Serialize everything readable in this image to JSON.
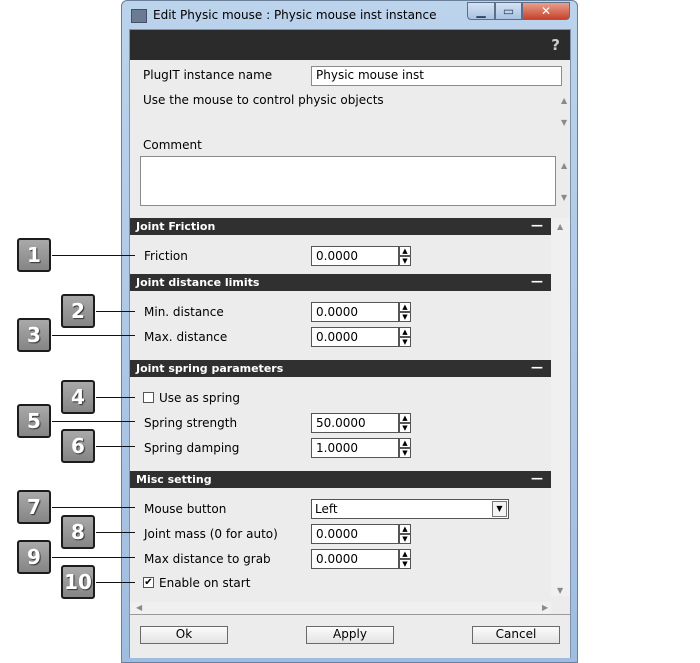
{
  "window": {
    "title": "Edit Physic mouse : Physic mouse inst instance",
    "minimize_glyph": "▁",
    "maximize_glyph": "▭",
    "close_glyph": "✕",
    "help_glyph": "?"
  },
  "instance": {
    "name_label": "PlugIT instance name",
    "name_value": "Physic mouse inst",
    "description": "Use the mouse to control physic objects",
    "comment_label": "Comment",
    "comment_value": ""
  },
  "sections": {
    "joint_friction": "Joint Friction",
    "joint_distance": "Joint distance limits",
    "joint_spring": "Joint spring parameters",
    "misc": "Misc setting",
    "collapse_glyph": "—"
  },
  "fields": {
    "friction": {
      "label": "Friction",
      "value": "0.0000"
    },
    "min_distance": {
      "label": "Min. distance",
      "value": "0.0000"
    },
    "max_distance": {
      "label": "Max. distance",
      "value": "0.0000"
    },
    "use_as_spring": {
      "label": "Use as spring",
      "checked_glyph": ""
    },
    "spring_strength": {
      "label": "Spring strength",
      "value": "50.0000"
    },
    "spring_damping": {
      "label": "Spring damping",
      "value": "1.0000"
    },
    "mouse_button": {
      "label": "Mouse button",
      "value": "Left"
    },
    "joint_mass": {
      "label": "Joint mass (0 for auto)",
      "value": "0.0000"
    },
    "max_grab_distance": {
      "label": "Max distance to grab",
      "value": "0.0000"
    },
    "enable_on_start": {
      "label": "Enable on start",
      "checked_glyph": "✔"
    }
  },
  "buttons": {
    "ok": "Ok",
    "apply": "Apply",
    "cancel": "Cancel"
  },
  "callouts": [
    "1",
    "2",
    "3",
    "4",
    "5",
    "6",
    "7",
    "8",
    "9",
    "10"
  ],
  "glyphs": {
    "up": "▲",
    "down": "▼",
    "left": "◀",
    "right": "▶"
  }
}
